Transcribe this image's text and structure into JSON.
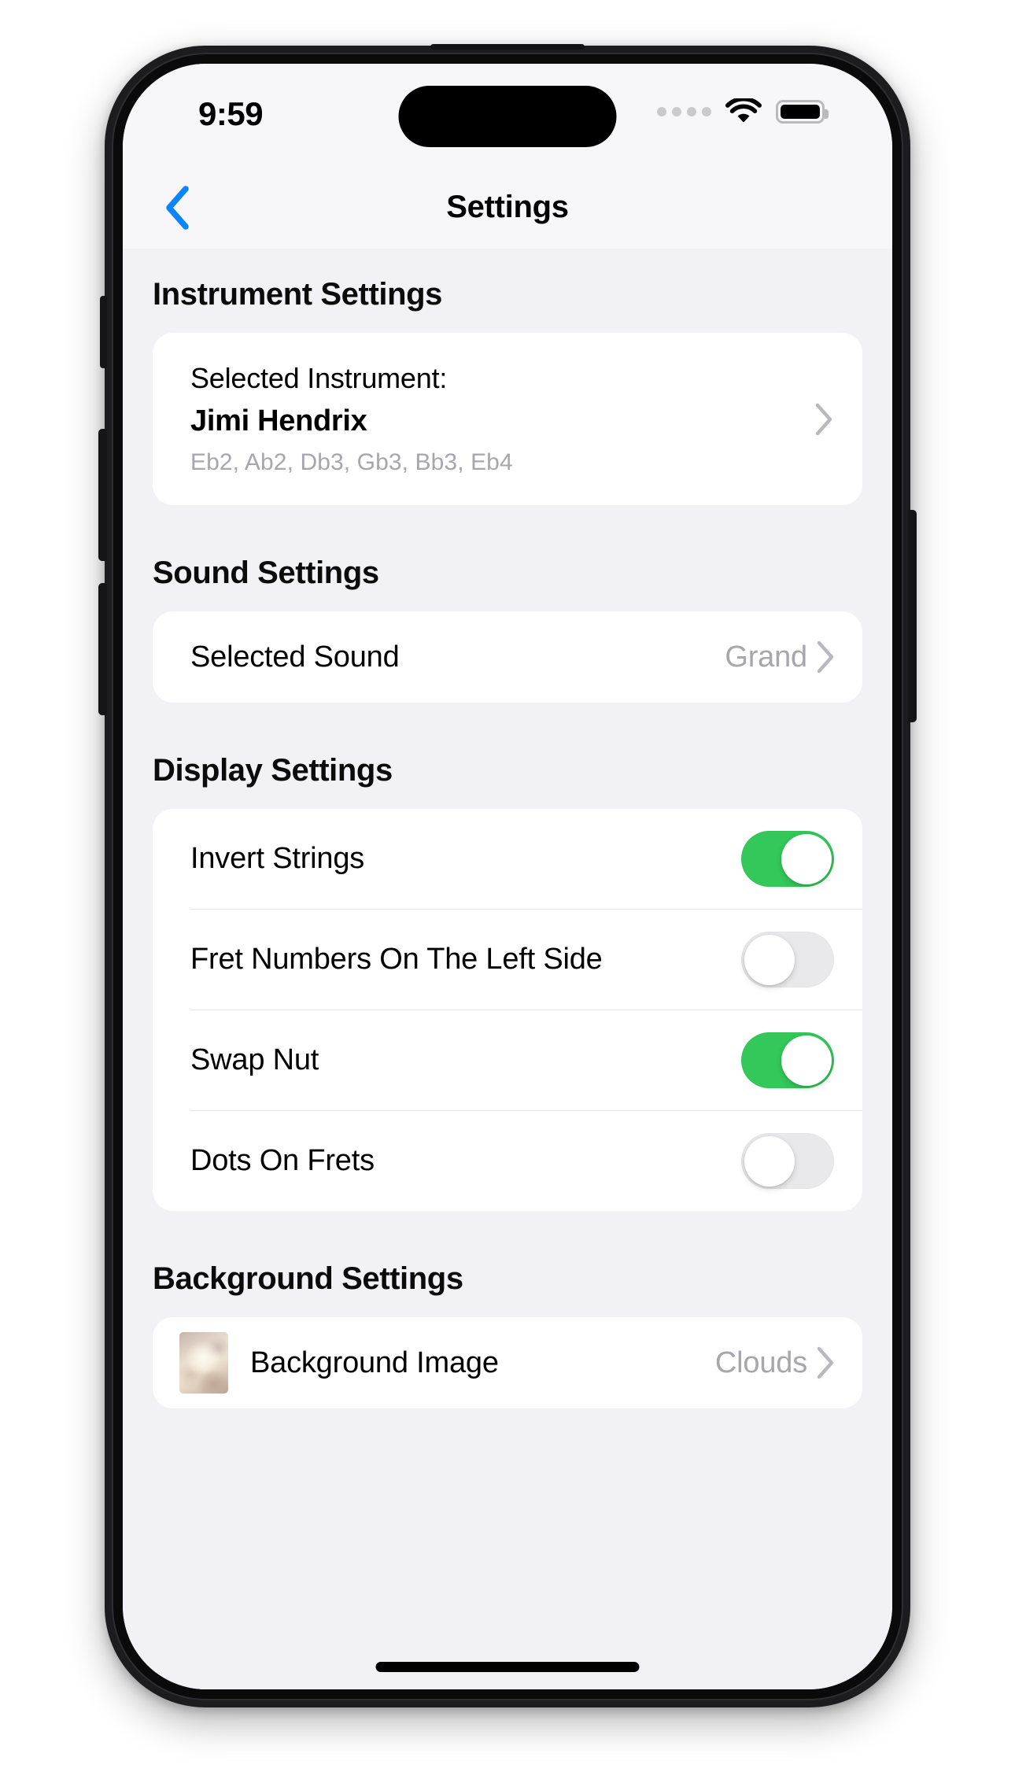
{
  "status_bar": {
    "time": "9:59",
    "signal_icon": "cellular-dots-icon",
    "wifi_icon": "wifi-icon",
    "battery_icon": "battery-full-icon"
  },
  "nav": {
    "back_icon": "chevron-left-icon",
    "title": "Settings"
  },
  "sections": {
    "instrument": {
      "header": "Instrument Settings",
      "row": {
        "label": "Selected Instrument:",
        "name": "Jimi Hendrix",
        "tuning": "Eb2, Ab2, Db3, Gb3, Bb3, Eb4",
        "chevron_icon": "chevron-right-icon"
      }
    },
    "sound": {
      "header": "Sound Settings",
      "row": {
        "label": "Selected Sound",
        "value": "Grand",
        "chevron_icon": "chevron-right-icon"
      }
    },
    "display": {
      "header": "Display Settings",
      "rows": [
        {
          "label": "Invert Strings",
          "state": "on"
        },
        {
          "label": "Fret Numbers On The Left Side",
          "state": "off"
        },
        {
          "label": "Swap Nut",
          "state": "on"
        },
        {
          "label": "Dots On Frets",
          "state": "off"
        }
      ]
    },
    "background": {
      "header": "Background Settings",
      "row": {
        "thumbnail_icon": "clouds-thumbnail-image",
        "label": "Background Image",
        "value": "Clouds",
        "chevron_icon": "chevron-right-icon"
      }
    }
  },
  "colors": {
    "accent_blue": "#0a84ff",
    "toggle_on_green": "#34c759",
    "toggle_off_gray": "#e9e9eb",
    "screen_background": "#f2f1f6",
    "card_background": "#ffffff",
    "secondary_text": "#a6a6ac"
  },
  "home_indicator": "home-indicator-bar"
}
